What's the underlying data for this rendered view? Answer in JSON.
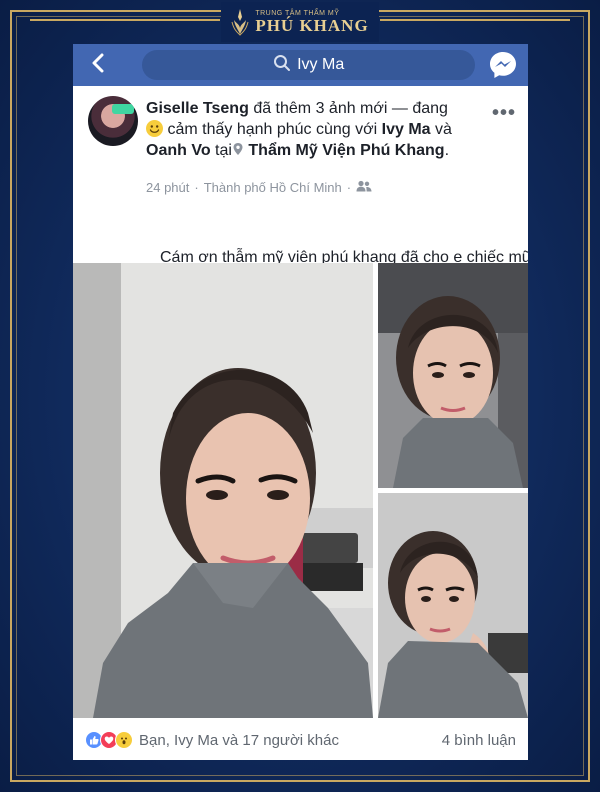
{
  "brand": {
    "subtitle": "TRUNG TÂM THẨM MỸ",
    "name": "PHÚ KHANG",
    "color": "#c9a861"
  },
  "navbar": {
    "search_query": "Ivy Ma",
    "back_icon": "chevron-left-icon",
    "messenger_icon": "messenger-icon",
    "color": "#4267b2"
  },
  "post": {
    "author": "Giselle Tseng",
    "action_text": "đã thêm 3 ảnh mới — đang",
    "feeling_text": "cảm thấy hạnh phúc cùng với",
    "tagged_1": "Ivy Ma",
    "conj": "và",
    "tagged_2": "Oanh Vo",
    "at": "tại",
    "place": "Thẩm Mỹ Viện  Phú Khang",
    "period": ".",
    "time": "24 phút",
    "dot": "·",
    "location": "Thành phố Hồ Chí Minh",
    "dot2": "·",
    "message": "Cám ơn thẫm mỹ viên phú khang đã cho e chiếc mũi mới đẹp"
  },
  "reactions": {
    "summary": "Bạn, Ivy Ma và 17 người khác",
    "comments": "4 bình luận",
    "icons": [
      "like-icon",
      "love-icon",
      "wow-icon"
    ]
  }
}
